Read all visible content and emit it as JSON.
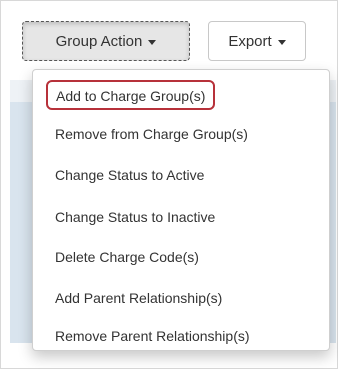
{
  "toolbar": {
    "group_action_label": "Group Action",
    "export_label": "Export"
  },
  "menu": {
    "items": [
      {
        "label": "Add to Charge Group(s)",
        "highlighted": true
      },
      {
        "label": "Remove from Charge Group(s)"
      },
      {
        "label": "Change Status to Active"
      },
      {
        "label": "Change Status to Inactive"
      },
      {
        "label": "Delete Charge Code(s)"
      },
      {
        "label": "Add Parent Relationship(s)"
      },
      {
        "label": "Remove Parent Relationship(s)"
      }
    ]
  },
  "colors": {
    "highlight_border": "#b7313a",
    "page_background": "#d9e4ee",
    "text": "#333333"
  },
  "icons": {
    "caret": "caret-down-icon"
  }
}
